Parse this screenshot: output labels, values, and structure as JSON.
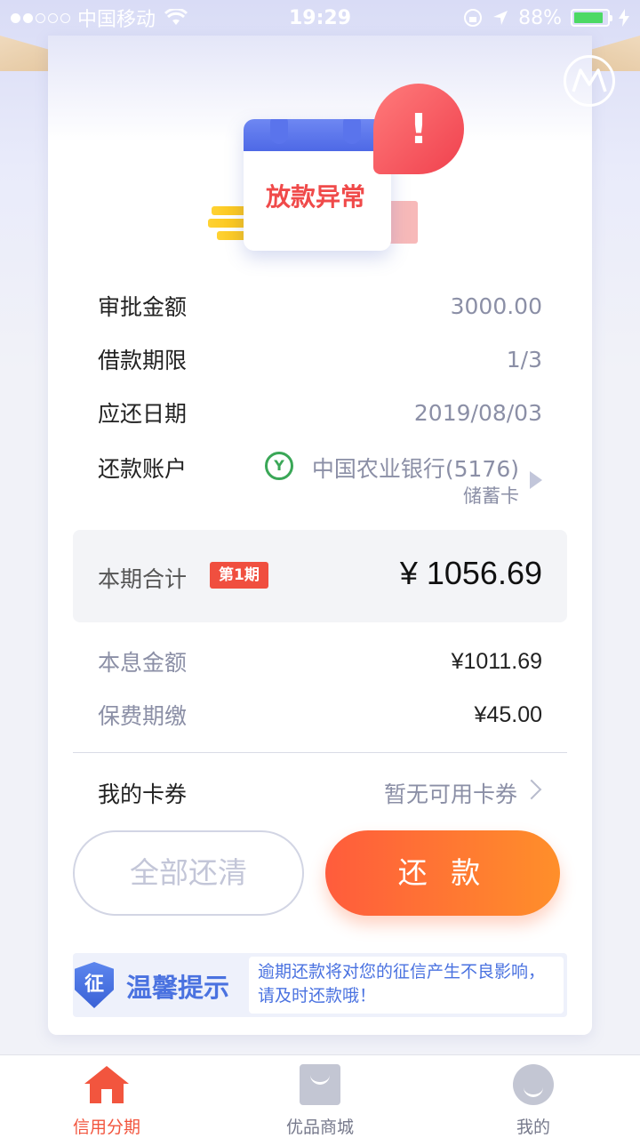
{
  "status_bar": {
    "carrier": "中国移动",
    "time": "19:29",
    "battery": "88%"
  },
  "hero": {
    "title": "放款异常",
    "alert_mark": "!"
  },
  "details": {
    "approval_label": "审批金额",
    "approval_value": "3000.00",
    "term_label": "借款期限",
    "term_value": "1/3",
    "due_label": "应还日期",
    "due_value": "2019/08/03",
    "account_label": "还款账户",
    "bank_name": "中国农业银行(5176)",
    "card_type": "储蓄卡"
  },
  "total": {
    "label": "本期合计",
    "badge": "第1期",
    "amount": "¥ 1056.69"
  },
  "breakdown": {
    "principal_label": "本息金额",
    "principal_value": "¥1011.69",
    "fee_label": "保费期缴",
    "fee_value": "¥45.00"
  },
  "coupon": {
    "label": "我的卡券",
    "value": "暂无可用卡券"
  },
  "buttons": {
    "clear_all": "全部还清",
    "repay": "还 款"
  },
  "tip": {
    "shield_char": "征",
    "title": "温馨提示",
    "text": "逾期还款将对您的征信产生不良影响，请及时还款哦！"
  },
  "tabs": [
    {
      "label": "信用分期",
      "icon": "home-icon",
      "active": true
    },
    {
      "label": "优品商城",
      "icon": "shopping-bag-icon",
      "active": false
    },
    {
      "label": "我的",
      "icon": "user-icon",
      "active": false
    }
  ],
  "colors": {
    "accent": "#ff6a36",
    "danger": "#f04a4a",
    "info": "#4a72e0"
  }
}
